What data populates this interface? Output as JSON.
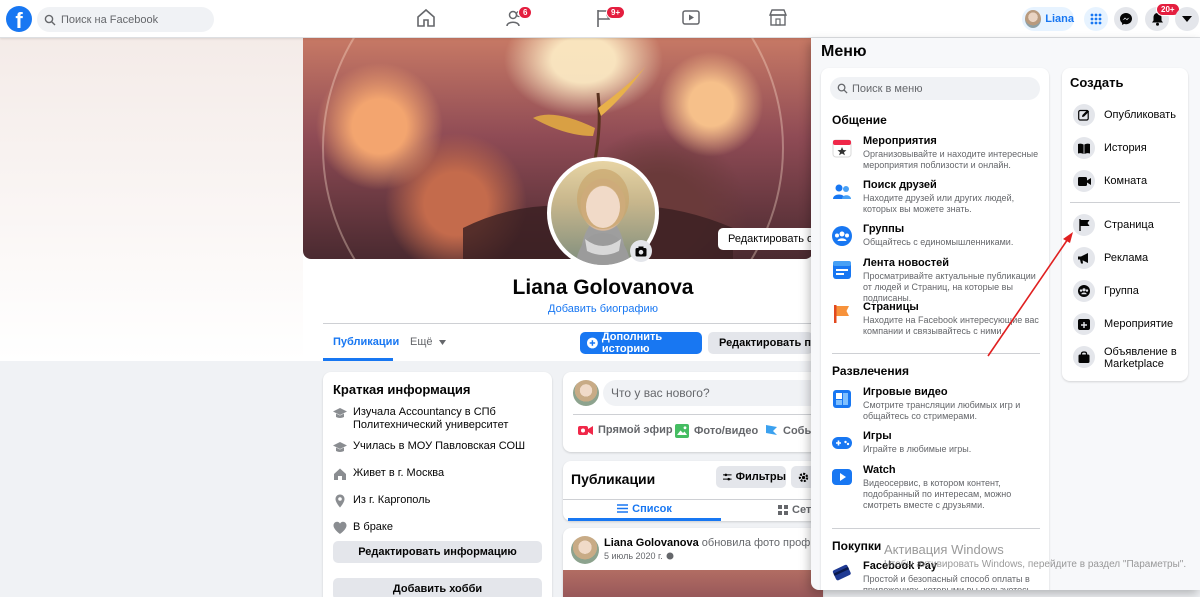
{
  "topbar": {
    "logo": "f",
    "search_placeholder": "Поиск на Facebook",
    "badges": {
      "friends": "6",
      "pages": "9+",
      "notifications": "20+"
    },
    "user_name": "Liana",
    "icons": [
      "home-icon",
      "friends-icon",
      "flag-icon",
      "watch-icon",
      "marketplace-icon",
      "apps-grid-icon",
      "messenger-icon",
      "bell-icon",
      "caret-down-icon"
    ]
  },
  "profile": {
    "edit_cover": "Редактировать о",
    "name": "Liana Golovanova",
    "add_bio": "Добавить биографию",
    "tabs": {
      "publications": "Публикации",
      "more": "Ещё"
    },
    "add_story": "Дополнить историю",
    "edit_profile": "Редактировать про"
  },
  "intro": {
    "title": "Краткая информация",
    "rows": [
      {
        "icon": "graduation-cap-icon",
        "text": "Изучала Accountancy в СПб Политехнический университет"
      },
      {
        "icon": "graduation-cap-icon",
        "text": "Училась в МОУ Павловская СОШ"
      },
      {
        "icon": "home-icon",
        "text": "Живет в г. Москва"
      },
      {
        "icon": "location-pin-icon",
        "text": "Из г. Каргополь"
      },
      {
        "icon": "heart-icon",
        "text": "В браке"
      }
    ],
    "edit_info": "Редактировать информацию",
    "add_hobby": "Добавить хобби"
  },
  "composer": {
    "placeholder": "Что у вас нового?",
    "live": "Прямой эфир",
    "photo": "Фото/видео",
    "event": "Событ"
  },
  "posts": {
    "title": "Публикации",
    "filters": "Фильтры",
    "list": "Список",
    "grid": "Сетк",
    "post_author": "Liana Golovanova",
    "post_action": " обновила фото профиля.",
    "post_date": "5 июль 2020 г."
  },
  "menu": {
    "title": "Меню",
    "search_placeholder": "Поиск в меню",
    "section_social": "Общение",
    "social": [
      {
        "title": "Мероприятия",
        "desc": "Организовывайте и находите интересные мероприятия поблизости и онлайн."
      },
      {
        "title": "Поиск друзей",
        "desc": "Находите друзей или других людей, которых вы можете знать."
      },
      {
        "title": "Группы",
        "desc": "Общайтесь с единомышленниками."
      },
      {
        "title": "Лента новостей",
        "desc": "Просматривайте актуальные публикации от людей и Страниц, на которые вы подписаны."
      },
      {
        "title": "Страницы",
        "desc": "Находите на Facebook интересующие вас компании и связывайтесь с ними."
      }
    ],
    "section_entertainment": "Развлечения",
    "entertainment": [
      {
        "title": "Игровые видео",
        "desc": "Смотрите трансляции любимых игр и общайтесь со стримерами."
      },
      {
        "title": "Игры",
        "desc": "Играйте в любимые игры."
      },
      {
        "title": "Watch",
        "desc": "Видеосервис, в котором контент, подобранный по интересам, можно смотреть вместе с друзьями."
      }
    ],
    "section_shopping": "Покупки",
    "shopping": [
      {
        "title": "Facebook Pay",
        "desc": "Простой и безопасный способ оплаты в приложениях, которыми вы пользуетесь."
      }
    ],
    "create_title": "Создать",
    "create": [
      {
        "icon": "edit-icon",
        "label": "Опубликовать"
      },
      {
        "icon": "book-icon",
        "label": "История"
      },
      {
        "icon": "video-camera-icon",
        "label": "Комната"
      },
      {
        "icon": "flag-icon",
        "label": "Страница"
      },
      {
        "icon": "megaphone-icon",
        "label": "Реклама"
      },
      {
        "icon": "group-icon",
        "label": "Группа"
      },
      {
        "icon": "calendar-plus-icon",
        "label": "Мероприятие"
      },
      {
        "icon": "shopping-bag-icon",
        "label": "Объявление в Marketplace"
      }
    ]
  },
  "watermark": {
    "line1": "Активация Windows",
    "line2": "Чтобы активировать Windows, перейдите в раздел \"Параметры\"."
  },
  "colors": {
    "brand": "#1877f2",
    "annotation_arrow": "#e02020",
    "badge": "#e41e3f"
  }
}
